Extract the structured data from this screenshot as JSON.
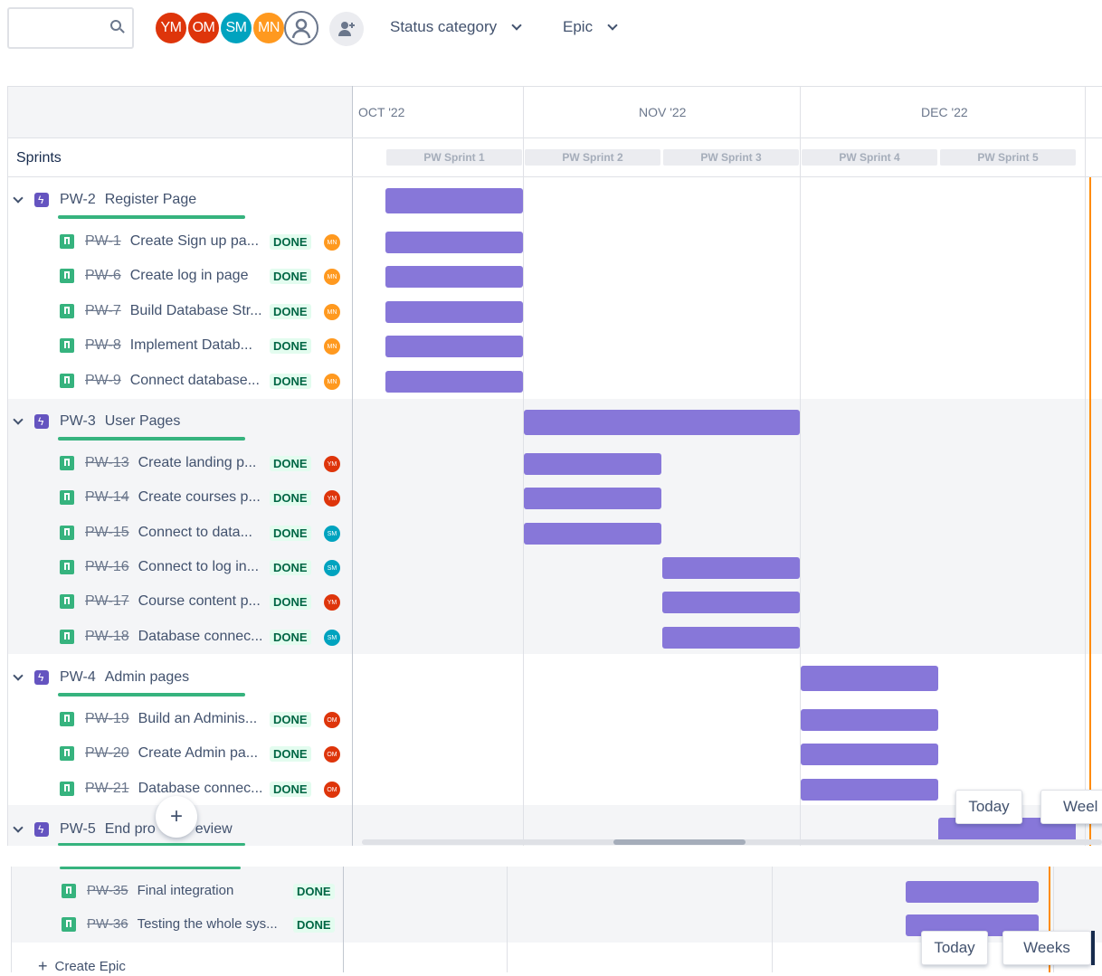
{
  "toolbar": {
    "avatars": [
      {
        "initials": "YM",
        "color": "#de350b"
      },
      {
        "initials": "OM",
        "color": "#de350b"
      },
      {
        "initials": "SM",
        "color": "#00a3bf"
      },
      {
        "initials": "MN",
        "color": "#ff991f"
      }
    ],
    "status_filter": "Status category",
    "epic_filter": "Epic"
  },
  "timeline": {
    "months": [
      "OCT '22",
      "NOV '22",
      "DEC '22"
    ],
    "sprints_header": "Sprints",
    "sprints": [
      "PW Sprint 1",
      "PW Sprint 2",
      "PW Sprint 3",
      "PW Sprint 4",
      "PW Sprint 5"
    ]
  },
  "epics": [
    {
      "key": "PW-2",
      "title": "Register Page",
      "items": [
        {
          "key": "PW-1",
          "title": "Create Sign up pa...",
          "status": "DONE",
          "assignee": "MN"
        },
        {
          "key": "PW-6",
          "title": "Create log in page",
          "status": "DONE",
          "assignee": "MN"
        },
        {
          "key": "PW-7",
          "title": "Build Database Str...",
          "status": "DONE",
          "assignee": "MN"
        },
        {
          "key": "PW-8",
          "title": "Implement Datab...",
          "status": "DONE",
          "assignee": "MN"
        },
        {
          "key": "PW-9",
          "title": "Connect database...",
          "status": "DONE",
          "assignee": "MN"
        }
      ]
    },
    {
      "key": "PW-3",
      "title": "User Pages",
      "items": [
        {
          "key": "PW-13",
          "title": "Create landing p...",
          "status": "DONE",
          "assignee": "YM"
        },
        {
          "key": "PW-14",
          "title": "Create courses p...",
          "status": "DONE",
          "assignee": "YM"
        },
        {
          "key": "PW-15",
          "title": "Connect to data...",
          "status": "DONE",
          "assignee": "SM"
        },
        {
          "key": "PW-16",
          "title": "Connect to log in...",
          "status": "DONE",
          "assignee": "SM"
        },
        {
          "key": "PW-17",
          "title": "Course content p...",
          "status": "DONE",
          "assignee": "YM"
        },
        {
          "key": "PW-18",
          "title": "Database connec...",
          "status": "DONE",
          "assignee": "SM"
        }
      ]
    },
    {
      "key": "PW-4",
      "title": "Admin pages",
      "items": [
        {
          "key": "PW-19",
          "title": "Build an Adminis...",
          "status": "DONE",
          "assignee": "OM"
        },
        {
          "key": "PW-20",
          "title": "Create Admin pa...",
          "status": "DONE",
          "assignee": "OM"
        },
        {
          "key": "PW-21",
          "title": "Database connec...",
          "status": "DONE",
          "assignee": "OM"
        }
      ]
    },
    {
      "key": "PW-5",
      "title": "End pro",
      "title_tail": "eview",
      "items": []
    }
  ],
  "bottom_items": [
    {
      "key": "PW-35",
      "title": "Final integration",
      "status": "DONE"
    },
    {
      "key": "PW-36",
      "title": "Testing the whole sys...",
      "status": "DONE"
    }
  ],
  "create_epic": "Create Epic",
  "view_buttons": {
    "today": "Today",
    "weeks": "Weeks",
    "weeks_cut": "Weel"
  },
  "colors": {
    "bar": "#8777d9",
    "done_text": "#006644",
    "accent_today": "#ff8b00"
  }
}
